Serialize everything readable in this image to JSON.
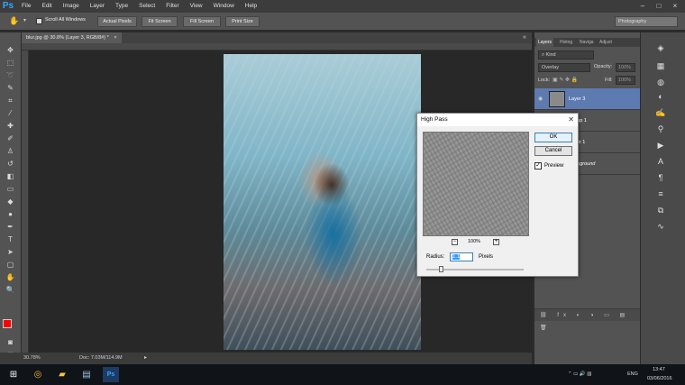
{
  "app": {
    "logo": "Ps"
  },
  "menu": [
    "File",
    "Edit",
    "Image",
    "Layer",
    "Type",
    "Select",
    "Filter",
    "View",
    "Window",
    "Help"
  ],
  "options_bar": {
    "scroll_all_label": "Scroll All Windows",
    "actual_pixels": "Actual Pixels",
    "fit_screen": "Fit Screen",
    "fill_screen": "Fill Screen",
    "print_size": "Print Size",
    "workspace": "Photography"
  },
  "document": {
    "tab_title": "blur.jpg @ 30.8% (Layer 3, RGB/8#) *"
  },
  "status": {
    "zoom": "30.78%",
    "doc_size": "Doc: 7.03M/114.9M"
  },
  "layers_panel": {
    "tabs": [
      "Layers",
      "Histog",
      "Naviga",
      "Adjust"
    ],
    "filter_kind": "Kind",
    "blend_mode": "Overlay",
    "opacity_label": "Opacity:",
    "opacity_value": "100%",
    "lock_label": "Lock:",
    "fill_label": "Fill:",
    "fill_value": "100%",
    "layers": [
      {
        "name": "Layer 3",
        "selected": true
      },
      {
        "name": "Group 1",
        "selected": false
      },
      {
        "name": "Layer 1",
        "selected": false
      },
      {
        "name": "Background",
        "selected": false
      }
    ]
  },
  "dialog": {
    "title": "High Pass",
    "ok": "OK",
    "cancel": "Cancel",
    "preview_label": "Preview",
    "preview_checked": true,
    "zoom": "100%",
    "radius_label": "Radius:",
    "radius_value": "1.1",
    "radius_unit": "Pixels"
  },
  "taskbar": {
    "language": "ENG",
    "time": "13:47",
    "date": "03/06/2016"
  },
  "colors": {
    "foreground": "#ff0000",
    "background": "#000000",
    "selection": "#5d7bb0",
    "ps_blue": "#31a8ff"
  }
}
